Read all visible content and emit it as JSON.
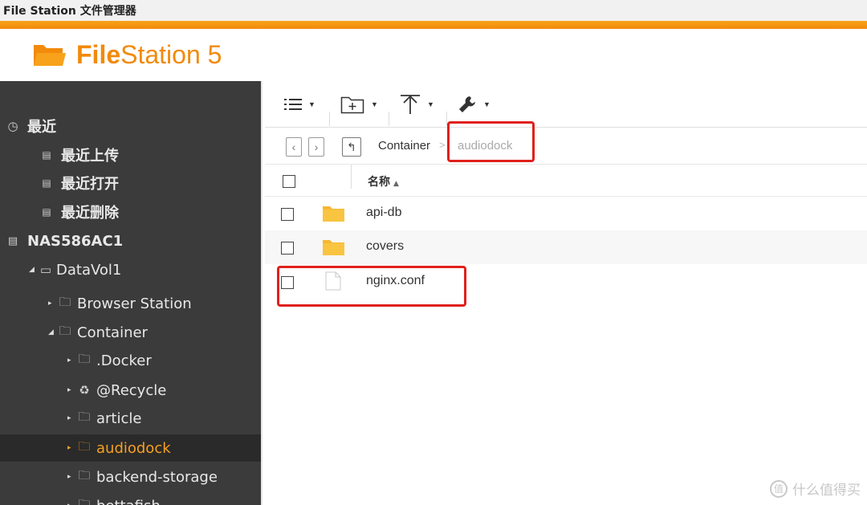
{
  "window": {
    "title": "File Station 文件管理器"
  },
  "header": {
    "logo_bold": "File",
    "logo_rest": "Station 5"
  },
  "colors": {
    "accent": "#f28a0a",
    "selected_text": "#f6a020",
    "sidebar_bg": "#3b3b3b",
    "annotation": "#e0201c"
  },
  "sidebar": {
    "recent": {
      "label": "最近",
      "icon": "clock-icon"
    },
    "recent_upload": {
      "label": "最近上传",
      "icon": "list-icon"
    },
    "recent_open": {
      "label": "最近打开",
      "icon": "list-icon"
    },
    "recent_delete": {
      "label": "最近删除",
      "icon": "list-icon"
    },
    "nas": {
      "label": "NAS586AC1",
      "icon": "server-icon"
    },
    "volume": {
      "label": "DataVol1",
      "icon": "drive-icon"
    },
    "browser_station": {
      "label": "Browser Station",
      "icon": "folder-icon"
    },
    "container": {
      "label": "Container",
      "icon": "folder-icon"
    },
    "docker": {
      "label": ".Docker",
      "icon": "folder-icon"
    },
    "recycle": {
      "label": "@Recycle",
      "icon": "recycle-icon"
    },
    "article": {
      "label": "article",
      "icon": "folder-icon"
    },
    "audiodock": {
      "label": "audiodock",
      "icon": "folder-icon",
      "selected": true
    },
    "backend_storage": {
      "label": "backend-storage",
      "icon": "folder-icon"
    },
    "bettafish": {
      "label": "bettafish",
      "icon": "folder-icon"
    }
  },
  "toolbar": {
    "view": {
      "icon": "list-view-icon"
    },
    "new_folder": {
      "icon": "new-folder-icon"
    },
    "upload": {
      "icon": "upload-icon"
    },
    "tools": {
      "icon": "wrench-icon"
    }
  },
  "pathbar": {
    "breadcrumb": [
      "Container",
      "audiodock"
    ],
    "separator": ">"
  },
  "list": {
    "header_name": "名称",
    "rows": [
      {
        "name": "api-db",
        "type": "folder"
      },
      {
        "name": "covers",
        "type": "folder"
      },
      {
        "name": "nginx.conf",
        "type": "file"
      }
    ]
  },
  "watermark": {
    "text": "什么值得买",
    "icon": "zhi-icon"
  }
}
